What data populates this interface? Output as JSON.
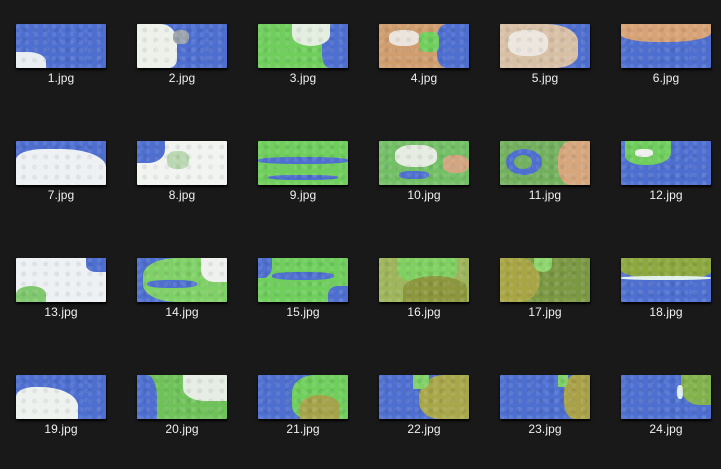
{
  "files": [
    {
      "name": "1.jpg",
      "base": "#4e6fd0",
      "layers": [
        {
          "c": "#e9eef2",
          "l": 0,
          "t": 28,
          "w": 30,
          "h": 16,
          "r": "0 60% 0 0"
        }
      ]
    },
    {
      "name": "2.jpg",
      "base": "#4e6fd0",
      "layers": [
        {
          "c": "#edf1ea",
          "l": 0,
          "t": 0,
          "w": 40,
          "h": 44,
          "r": "0 40% 20% 0"
        },
        {
          "c": "#9aa3ad",
          "l": 36,
          "t": 6,
          "w": 16,
          "h": 14,
          "r": "40%"
        }
      ]
    },
    {
      "name": "3.jpg",
      "base": "#6fce5c",
      "layers": [
        {
          "c": "#4e6fd0",
          "l": 64,
          "t": 0,
          "w": 26,
          "h": 44,
          "r": "40% 0 0 30%"
        },
        {
          "c": "#e3eee0",
          "l": 34,
          "t": 0,
          "w": 38,
          "h": 22,
          "r": "0 0 50% 50%"
        }
      ]
    },
    {
      "name": "4.jpg",
      "base": "#cf9d6e",
      "layers": [
        {
          "c": "#4e6fd0",
          "l": 58,
          "t": 0,
          "w": 32,
          "h": 44,
          "r": "30% 0 0 30%"
        },
        {
          "c": "#ebe4dc",
          "l": 10,
          "t": 6,
          "w": 30,
          "h": 16,
          "r": "40%"
        },
        {
          "c": "#6fce5c",
          "l": 40,
          "t": 8,
          "w": 20,
          "h": 20,
          "r": "30%"
        }
      ]
    },
    {
      "name": "5.jpg",
      "base": "#4e6fd0",
      "layers": [
        {
          "c": "#d8c0a6",
          "l": 0,
          "t": 0,
          "w": 78,
          "h": 44,
          "r": "0 40% 30% 0"
        },
        {
          "c": "#ece6de",
          "l": 8,
          "t": 6,
          "w": 40,
          "h": 26,
          "r": "40%"
        }
      ]
    },
    {
      "name": "6.jpg",
      "base": "#4e6fd0",
      "layers": [
        {
          "c": "#d7a276",
          "l": 0,
          "t": 0,
          "w": 90,
          "h": 18,
          "r": "0 0 50% 40%"
        }
      ]
    },
    {
      "name": "7.jpg",
      "base": "#4e6fd0",
      "layers": [
        {
          "c": "#eef1f4",
          "l": 0,
          "t": 8,
          "w": 90,
          "h": 36,
          "r": "30% 50% 0 0"
        }
      ]
    },
    {
      "name": "8.jpg",
      "base": "#f2f4f1",
      "layers": [
        {
          "c": "#4e6fd0",
          "l": 0,
          "t": 0,
          "w": 28,
          "h": 22,
          "r": "0 0 60% 0"
        },
        {
          "c": "#b9d8b2",
          "l": 30,
          "t": 10,
          "w": 22,
          "h": 18,
          "r": "40%"
        }
      ]
    },
    {
      "name": "9.jpg",
      "base": "#6fce5c",
      "layers": [
        {
          "c": "#4e6fd0",
          "l": 0,
          "t": 16,
          "w": 90,
          "h": 7,
          "r": "40%"
        },
        {
          "c": "#4e6fd0",
          "l": 10,
          "t": 34,
          "w": 70,
          "h": 5,
          "r": "40%"
        }
      ]
    },
    {
      "name": "10.jpg",
      "base": "#73bf66",
      "layers": [
        {
          "c": "#e6ece2",
          "l": 16,
          "t": 4,
          "w": 42,
          "h": 22,
          "r": "40%"
        },
        {
          "c": "#d2a681",
          "l": 64,
          "t": 14,
          "w": 26,
          "h": 18,
          "r": "40%"
        },
        {
          "c": "#4e6fd0",
          "l": 20,
          "t": 30,
          "w": 30,
          "h": 8,
          "r": "40%"
        }
      ]
    },
    {
      "name": "11.jpg",
      "base": "#73b05e",
      "layers": [
        {
          "c": "#d6a67c",
          "l": 58,
          "t": 0,
          "w": 32,
          "h": 44,
          "r": "40% 0 0 40%"
        },
        {
          "c": "#4e6fd0",
          "l": 6,
          "t": 8,
          "w": 36,
          "h": 26,
          "r": "50%"
        },
        {
          "c": "#73b05e",
          "l": 14,
          "t": 14,
          "w": 18,
          "h": 14,
          "r": "50%"
        }
      ]
    },
    {
      "name": "12.jpg",
      "base": "#4e6fd0",
      "layers": [
        {
          "c": "#6fce5c",
          "l": 4,
          "t": 0,
          "w": 46,
          "h": 24,
          "r": "0 0 50% 40%"
        },
        {
          "c": "#eef0ec",
          "l": 14,
          "t": 8,
          "w": 18,
          "h": 8,
          "r": "40%"
        }
      ]
    },
    {
      "name": "13.jpg",
      "base": "#eef1f3",
      "layers": [
        {
          "c": "#4e6fd0",
          "l": 70,
          "t": 0,
          "w": 20,
          "h": 14,
          "r": "0 0 0 50%"
        },
        {
          "c": "#7fc86e",
          "l": 0,
          "t": 28,
          "w": 30,
          "h": 16,
          "r": "50% 50% 0 0"
        }
      ]
    },
    {
      "name": "14.jpg",
      "base": "#4e6fd0",
      "layers": [
        {
          "c": "#7fd066",
          "l": 6,
          "t": 0,
          "w": 84,
          "h": 44,
          "r": "40% 0 0 40%"
        },
        {
          "c": "#4e6fd0",
          "l": 10,
          "t": 22,
          "w": 50,
          "h": 8,
          "r": "40%"
        },
        {
          "c": "#eef1ee",
          "l": 64,
          "t": 0,
          "w": 26,
          "h": 24,
          "r": "0 0 0 50%"
        }
      ]
    },
    {
      "name": "15.jpg",
      "base": "#6fce5c",
      "layers": [
        {
          "c": "#4e6fd0",
          "l": 14,
          "t": 14,
          "w": 62,
          "h": 8,
          "r": "40%"
        },
        {
          "c": "#4e6fd0",
          "l": 0,
          "t": 0,
          "w": 14,
          "h": 20,
          "r": "0 0 60% 0"
        },
        {
          "c": "#4e6fd0",
          "l": 70,
          "t": 28,
          "w": 20,
          "h": 16,
          "r": "50% 0 0 0"
        }
      ]
    },
    {
      "name": "16.jpg",
      "base": "#9eb55b",
      "layers": [
        {
          "c": "#7fcf61",
          "l": 18,
          "t": 0,
          "w": 60,
          "h": 26,
          "r": "0 0 50% 50%"
        },
        {
          "c": "#8c973d",
          "l": 24,
          "t": 18,
          "w": 64,
          "h": 26,
          "r": "50% 50% 0 0"
        }
      ]
    },
    {
      "name": "17.jpg",
      "base": "#7b9843",
      "layers": [
        {
          "c": "#a8a544",
          "l": 0,
          "t": 0,
          "w": 40,
          "h": 44,
          "r": "0 50% 50% 0"
        },
        {
          "c": "#8ed56d",
          "l": 34,
          "t": 0,
          "w": 18,
          "h": 14,
          "r": "0 0 50% 50%"
        }
      ]
    },
    {
      "name": "18.jpg",
      "base": "#4e6fd0",
      "layers": [
        {
          "c": "#8ca83f",
          "l": 0,
          "t": 0,
          "w": 90,
          "h": 20,
          "r": "0 0 30% 40%"
        },
        {
          "c": "#e1f0ec",
          "l": 0,
          "t": 18,
          "w": 90,
          "h": 4,
          "r": "40%"
        }
      ]
    },
    {
      "name": "19.jpg",
      "base": "#4e6fd0",
      "layers": [
        {
          "c": "#eef2ee",
          "l": 0,
          "t": 12,
          "w": 62,
          "h": 32,
          "r": "30% 60% 0 0"
        }
      ]
    },
    {
      "name": "20.jpg",
      "base": "#6fc25a",
      "layers": [
        {
          "c": "#4e6fd0",
          "l": 0,
          "t": 0,
          "w": 20,
          "h": 44,
          "r": "0 50% 0 0"
        },
        {
          "c": "#e6ede4",
          "l": 46,
          "t": 0,
          "w": 44,
          "h": 26,
          "r": "0 0 0 50%"
        }
      ]
    },
    {
      "name": "21.jpg",
      "base": "#4e6fd0",
      "layers": [
        {
          "c": "#6fce5c",
          "l": 34,
          "t": 0,
          "w": 56,
          "h": 44,
          "r": "40% 0 0 30%"
        },
        {
          "c": "#a5a34a",
          "l": 42,
          "t": 20,
          "w": 40,
          "h": 24,
          "r": "50% 50% 0 0"
        }
      ]
    },
    {
      "name": "22.jpg",
      "base": "#4e6fd0",
      "layers": [
        {
          "c": "#a8a74a",
          "l": 40,
          "t": 0,
          "w": 50,
          "h": 44,
          "r": "50% 0 0 40%"
        },
        {
          "c": "#7fd066",
          "l": 34,
          "t": 0,
          "w": 16,
          "h": 14,
          "r": "0 0 50% 0"
        }
      ]
    },
    {
      "name": "23.jpg",
      "base": "#4e6fd0",
      "layers": [
        {
          "c": "#a8a147",
          "l": 64,
          "t": 0,
          "w": 26,
          "h": 44,
          "r": "40% 0 0 40%"
        },
        {
          "c": "#7fd066",
          "l": 58,
          "t": 0,
          "w": 10,
          "h": 12,
          "r": "0 0 50% 0"
        }
      ]
    },
    {
      "name": "24.jpg",
      "base": "#4e6fd0",
      "layers": [
        {
          "c": "#83b24c",
          "l": 60,
          "t": 0,
          "w": 30,
          "h": 30,
          "r": "0 0 0 60%"
        },
        {
          "c": "#e1f0ec",
          "l": 56,
          "t": 10,
          "w": 6,
          "h": 14,
          "r": "40%"
        }
      ]
    }
  ]
}
